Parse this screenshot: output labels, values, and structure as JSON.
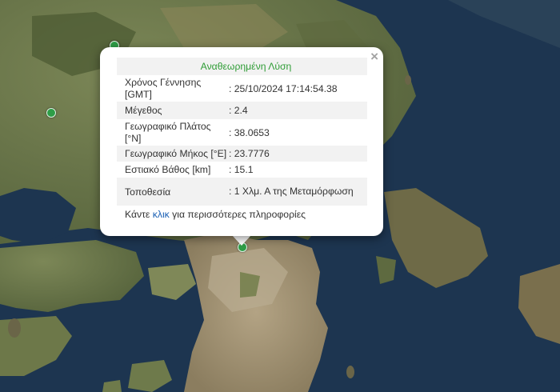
{
  "popup": {
    "title": "Αναθεωρημένη Λύση",
    "close_symbol": "×",
    "rows": [
      {
        "label": "Χρόνος Γέννησης [GMT]",
        "value": ": 25/10/2024 17:14:54.38"
      },
      {
        "label": "Μέγεθος",
        "value": ": 2.4"
      },
      {
        "label": "Γεωγραφικό Πλάτος [°N]",
        "value": ": 38.0653"
      },
      {
        "label": "Γεωγραφικό Μήκος [°E]",
        "value": ": 23.7776"
      },
      {
        "label": "Εστιακό Βάθος [km]",
        "value": ": 15.1"
      },
      {
        "label": "Τοποθεσία",
        "value": ": 1 Χλμ. Α της Μεταμόρφωση"
      }
    ],
    "more": {
      "prefix": "Κάντε",
      "link": "κλικ",
      "suffix": "για περισσότερες πληροφορίες"
    }
  },
  "colors": {
    "sea": "#1d3550",
    "land": "#6b7a4c",
    "urban": "#9e8d6e",
    "marker": "#2e9d47",
    "title_green": "#2f9d36",
    "link_blue": "#1a5fb4"
  },
  "markers": [
    "event-marker",
    "marker-nw",
    "marker-top"
  ]
}
